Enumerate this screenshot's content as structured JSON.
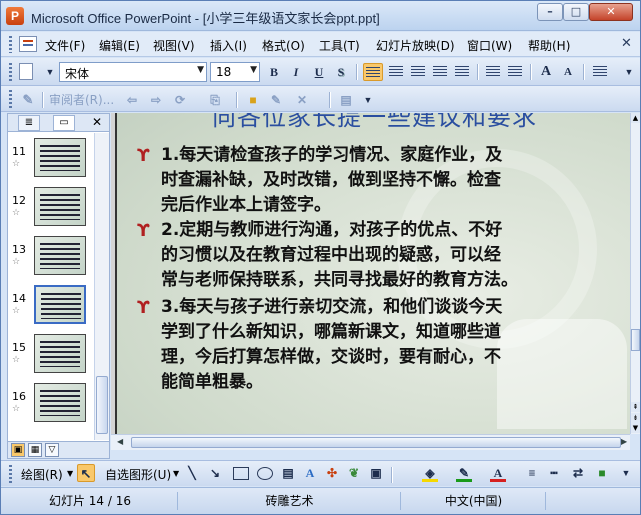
{
  "window": {
    "title": "Microsoft Office PowerPoint - [小学三年级语文家长会ppt.ppt]",
    "app_icon": "P",
    "minimize_glyph": "–",
    "maximize_glyph": "□",
    "close_glyph": "✕"
  },
  "menu": {
    "items": [
      "文件(F)",
      "编辑(E)",
      "视图(V)",
      "插入(I)",
      "格式(O)",
      "工具(T)",
      "幻灯片放映(D)",
      "窗口(W)",
      "帮助(H)"
    ],
    "close_glyph": "✕"
  },
  "format_toolbar": {
    "font_name": "宋体",
    "font_size": "18",
    "bold": "B",
    "italic": "I",
    "underline": "U",
    "shadow": "S",
    "grow_font": "A",
    "shrink_font": "A"
  },
  "review_toolbar": {
    "reviewer_label": "审阅者(R)..."
  },
  "slides_pane": {
    "slide_numbers": [
      "11",
      "12",
      "13",
      "14",
      "15",
      "16"
    ],
    "selected_index": 14,
    "close_glyph": "✕"
  },
  "slide": {
    "title": "向各位家长提一些建议和要求",
    "bullet_glyph": "ϒ",
    "paragraphs": [
      {
        "num": "1.",
        "lines": [
          "每天请检查孩子的学习情况、家庭作业，及",
          "时查漏补缺，及时改错，做到坚持不懈。检查",
          "完后作业本上请签字。"
        ]
      },
      {
        "num": "2.",
        "lines": [
          "定期与教师进行沟通，对孩子的优点、不好",
          "的习惯以及在教育过程中出现的疑惑，可以经",
          "常与老师保持联系，共同寻找最好的教育方法。"
        ]
      },
      {
        "num": "3.",
        "lines": [
          "每天与孩子进行亲切交流，和他们谈谈今天",
          "学到了什么新知识，哪篇新课文，知道哪些道",
          "理，今后打算怎样做，交谈时，要有耐心，不",
          "能简单粗暴。"
        ]
      }
    ]
  },
  "drawing_toolbar": {
    "draw_label": "绘图(R)",
    "autoshapes_label": "自选图形(U)",
    "colors": {
      "fill": "#f5d800",
      "line": "#1a9a1a",
      "font": "#d62020"
    }
  },
  "status": {
    "slide_position": "幻灯片 14 / 16",
    "design": "砖雕艺术",
    "language": "中文(中国)"
  }
}
